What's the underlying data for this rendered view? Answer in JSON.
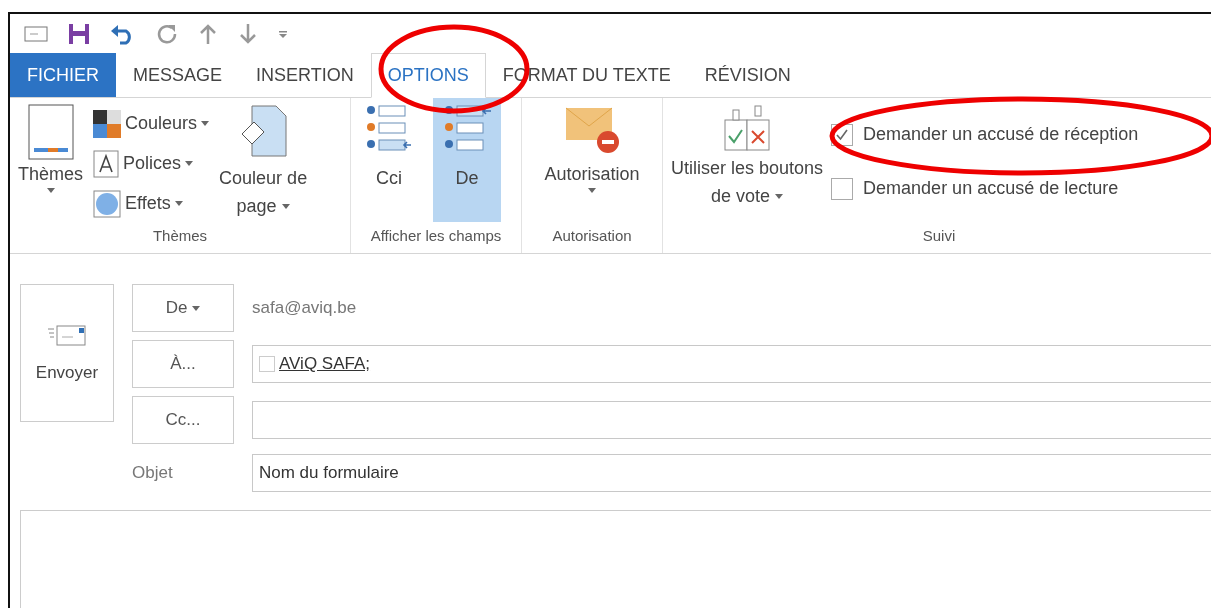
{
  "tabs": [
    {
      "label": "FICHIER",
      "kind": "file",
      "selected": false
    },
    {
      "label": "MESSAGE",
      "kind": "tab",
      "selected": false
    },
    {
      "label": "INSERTION",
      "kind": "tab",
      "selected": false
    },
    {
      "label": "OPTIONS",
      "kind": "tab",
      "selected": true
    },
    {
      "label": "FORMAT DU TEXTE",
      "kind": "tab",
      "selected": false
    },
    {
      "label": "RÉVISION",
      "kind": "tab",
      "selected": false
    }
  ],
  "ribbon": {
    "groups": [
      {
        "kind": "themes",
        "label": "Thèmes",
        "big_button": "Thèmes",
        "items": [
          {
            "label": "Couleurs",
            "kind": "colors"
          },
          {
            "label": "Polices",
            "kind": "fonts"
          },
          {
            "label": "Effets",
            "kind": "effects"
          }
        ],
        "page_color": [
          "Couleur de",
          "page"
        ]
      },
      {
        "kind": "fields",
        "label": "Afficher les champs",
        "buttons": [
          {
            "label": "Cci",
            "selected": false
          },
          {
            "label": "De",
            "selected": true
          }
        ]
      },
      {
        "kind": "permission",
        "label": "Autorisation",
        "button": "Autorisation"
      },
      {
        "kind": "tracking",
        "label": "Suivi",
        "vote": [
          "Utiliser les boutons",
          "de vote"
        ],
        "checks": [
          {
            "label": "Demander un accusé de réception",
            "checked": true
          },
          {
            "label": "Demander un accusé de lecture",
            "checked": false
          }
        ]
      }
    ]
  },
  "compose": {
    "send": "Envoyer",
    "from_button": "De",
    "from_value": "safa@aviq.be",
    "to_button": "À...",
    "to_value": "AViQ SAFA;",
    "cc_button": "Cc...",
    "subject_label": "Objet",
    "subject_value": "Nom du formulaire"
  },
  "annotations": [
    {
      "kind": "ellipse"
    },
    {
      "kind": "ellipse"
    }
  ]
}
